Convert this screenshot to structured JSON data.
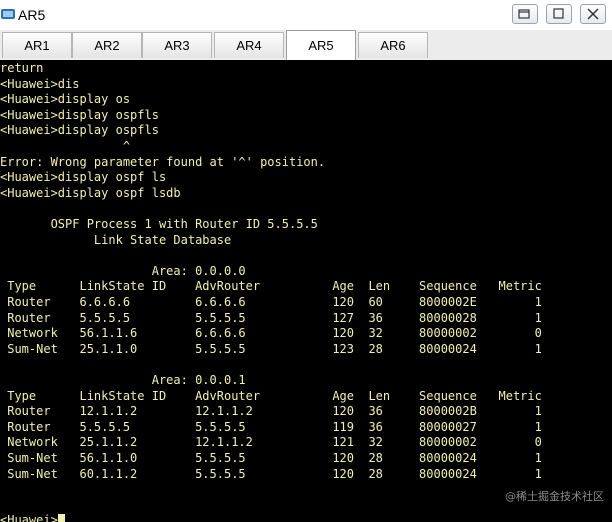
{
  "window": {
    "title": "AR5"
  },
  "tabs": [
    {
      "label": "AR1",
      "active": false
    },
    {
      "label": "AR2",
      "active": false
    },
    {
      "label": "AR3",
      "active": false
    },
    {
      "label": "AR4",
      "active": false
    },
    {
      "label": "AR5",
      "active": true
    },
    {
      "label": "AR6",
      "active": false
    }
  ],
  "terminal": {
    "text_color": "#f2f0b0",
    "lines": [
      "return",
      "<Huawei>dis",
      "<Huawei>display os",
      "<Huawei>display ospfls",
      "<Huawei>display ospfls",
      "                 ^",
      "Error: Wrong parameter found at '^' position.",
      "<Huawei>display ospf ls",
      "<Huawei>display ospf lsdb",
      "",
      "       OSPF Process 1 with Router ID 5.5.5.5",
      "             Link State Database",
      "",
      "                     Area: 0.0.0.0",
      " Type      LinkState ID    AdvRouter          Age  Len    Sequence   Metric",
      " Router    6.6.6.6         6.6.6.6            120  60     8000002E        1",
      " Router    5.5.5.5         5.5.5.5            127  36     80000028        1",
      " Network   56.1.1.6        6.6.6.6            120  32     80000002        0",
      " Sum-Net   25.1.1.0        5.5.5.5            123  28     80000024        1",
      "",
      "                     Area: 0.0.0.1",
      " Type      LinkState ID    AdvRouter          Age  Len    Sequence   Metric",
      " Router    12.1.1.2        12.1.1.2           120  36     8000002B        1",
      " Router    5.5.5.5         5.5.5.5            119  36     80000027        1",
      " Network   25.1.1.2        12.1.1.2           121  32     80000002        0",
      " Sum-Net   56.1.1.0        5.5.5.5            120  28     80000024        1",
      " Sum-Net   60.1.1.2        5.5.5.5            120  28     80000024        1",
      "",
      "",
      "<Huawei>"
    ]
  },
  "watermark": "@稀土掘金技术社区"
}
